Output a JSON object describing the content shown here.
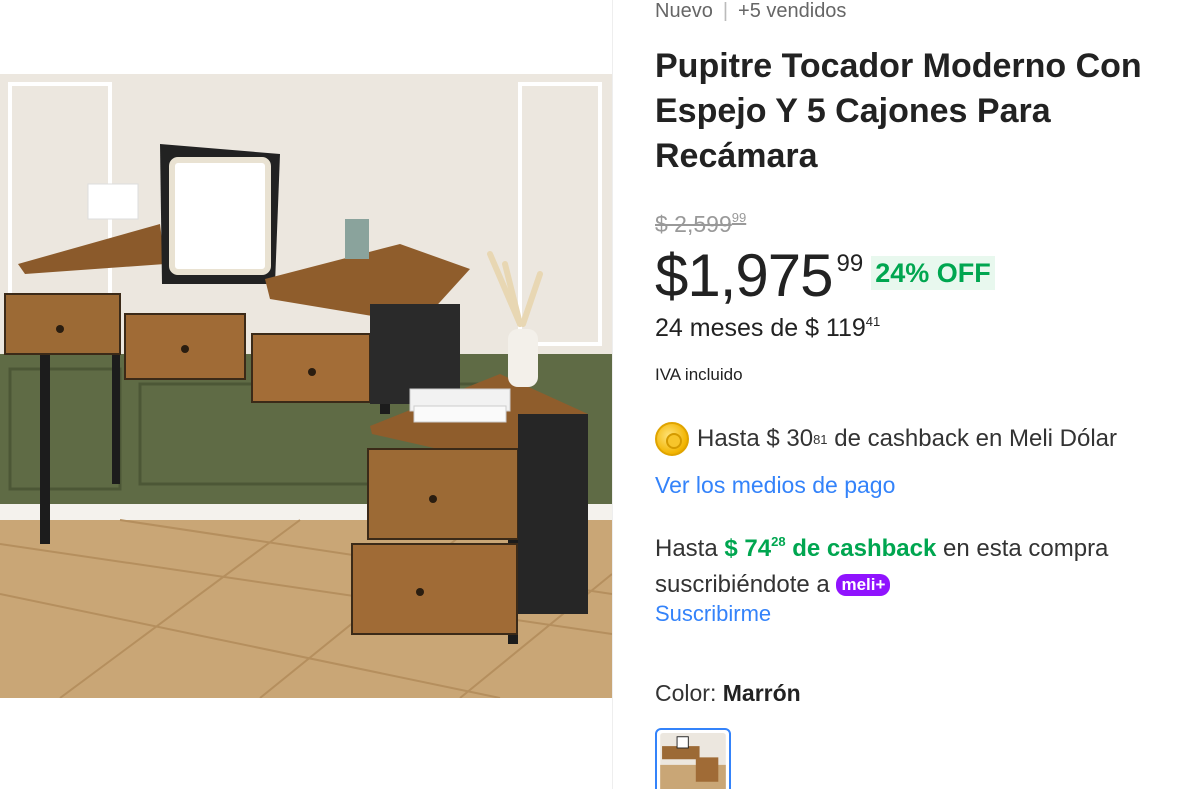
{
  "subtitle": {
    "condition": "Nuevo",
    "separator": "|",
    "sold": "+5 vendidos"
  },
  "title": "Pupitre Tocador Moderno Con Espejo Y 5 Cajones Para Recámara",
  "price": {
    "original_whole": "$ 2,599",
    "original_cents": "99",
    "current_whole": "$1,975",
    "current_cents": "99",
    "discount": "24% OFF"
  },
  "installments": {
    "text": "24 meses de $ 119",
    "cents": "41"
  },
  "tax_note": "IVA incluido",
  "meli_dolar": {
    "prefix": "Hasta $ 30",
    "cents": "81",
    "suffix": " de cashback en Meli Dólar"
  },
  "payment_link": "Ver los medios de pago",
  "meli_plus": {
    "prefix": "Hasta ",
    "amount": "$ 74",
    "cents": "28",
    "cashback_label": " de cashback",
    "suffix": " en esta compra suscribiéndote a ",
    "badge": "meli+"
  },
  "subscribe_link": "Suscribirme",
  "color": {
    "label": "Color: ",
    "value": "Marrón"
  },
  "colors": {
    "link": "#3483fa",
    "green": "#00a650",
    "meli_plus": "#9013fe"
  }
}
